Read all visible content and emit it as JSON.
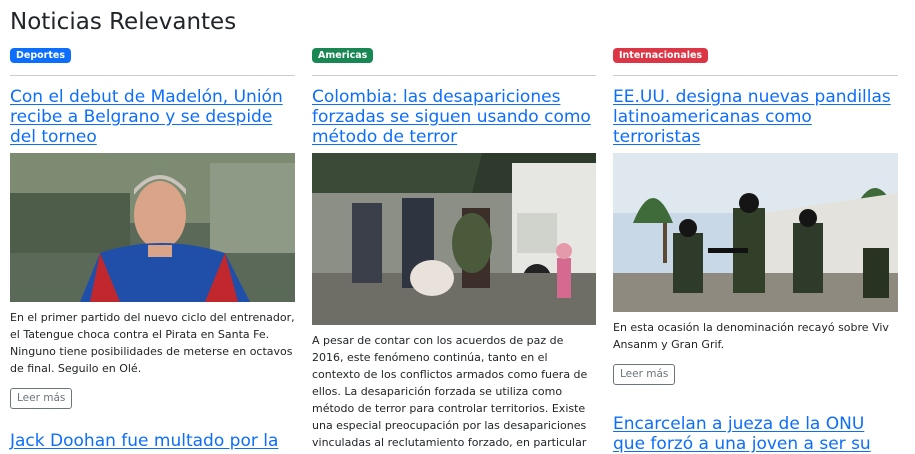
{
  "page": {
    "title": "Noticias Relevantes"
  },
  "columns": [
    {
      "badge": "Deportes",
      "badge_color": "#0d6efd",
      "headline": "Con el debut de Madelón, Unión recibe a Belgrano y se despide del torneo",
      "image_alt": "Entrenador con camiseta roja y azul",
      "description": "En el primer partido del nuevo ciclo del entrenador, el Tatengue choca contra el Pirata en Santa Fe. Ninguno tiene posibilidades de meterse en octavos de final. Seguilo en Olé.",
      "more_label": "Leer más",
      "next_headline": "Jack Doohan fue multado por la"
    },
    {
      "badge": "Americas",
      "badge_color": "#198754",
      "headline": "Colombia: las desapariciones forzadas se siguen usando como método de terror",
      "image_alt": "Personas desplazadas con equipaje junto a un camión",
      "description": "A pesar de contar con los acuerdos de paz de 2016, este fenómeno continúa, tanto en el contexto de los conflictos armados como fuera de ellos. La desaparición forzada se utiliza como método de terror para controlar territorios. Existe una especial preocupación por las desapariciones vinculadas al reclutamiento forzado, en particular"
    },
    {
      "badge": "Internacionales",
      "badge_color": "#dc3545",
      "headline": "EE.UU. designa nuevas pandillas latinoamericanas como terroristas",
      "image_alt": "Agentes armados en operativo",
      "description": "En esta ocasión la denominación recayó sobre Viv Ansanm y Gran Grif.",
      "more_label": "Leer más",
      "next_headline": "Encarcelan a jueza de la ONU que forzó a una joven a ser su"
    }
  ]
}
